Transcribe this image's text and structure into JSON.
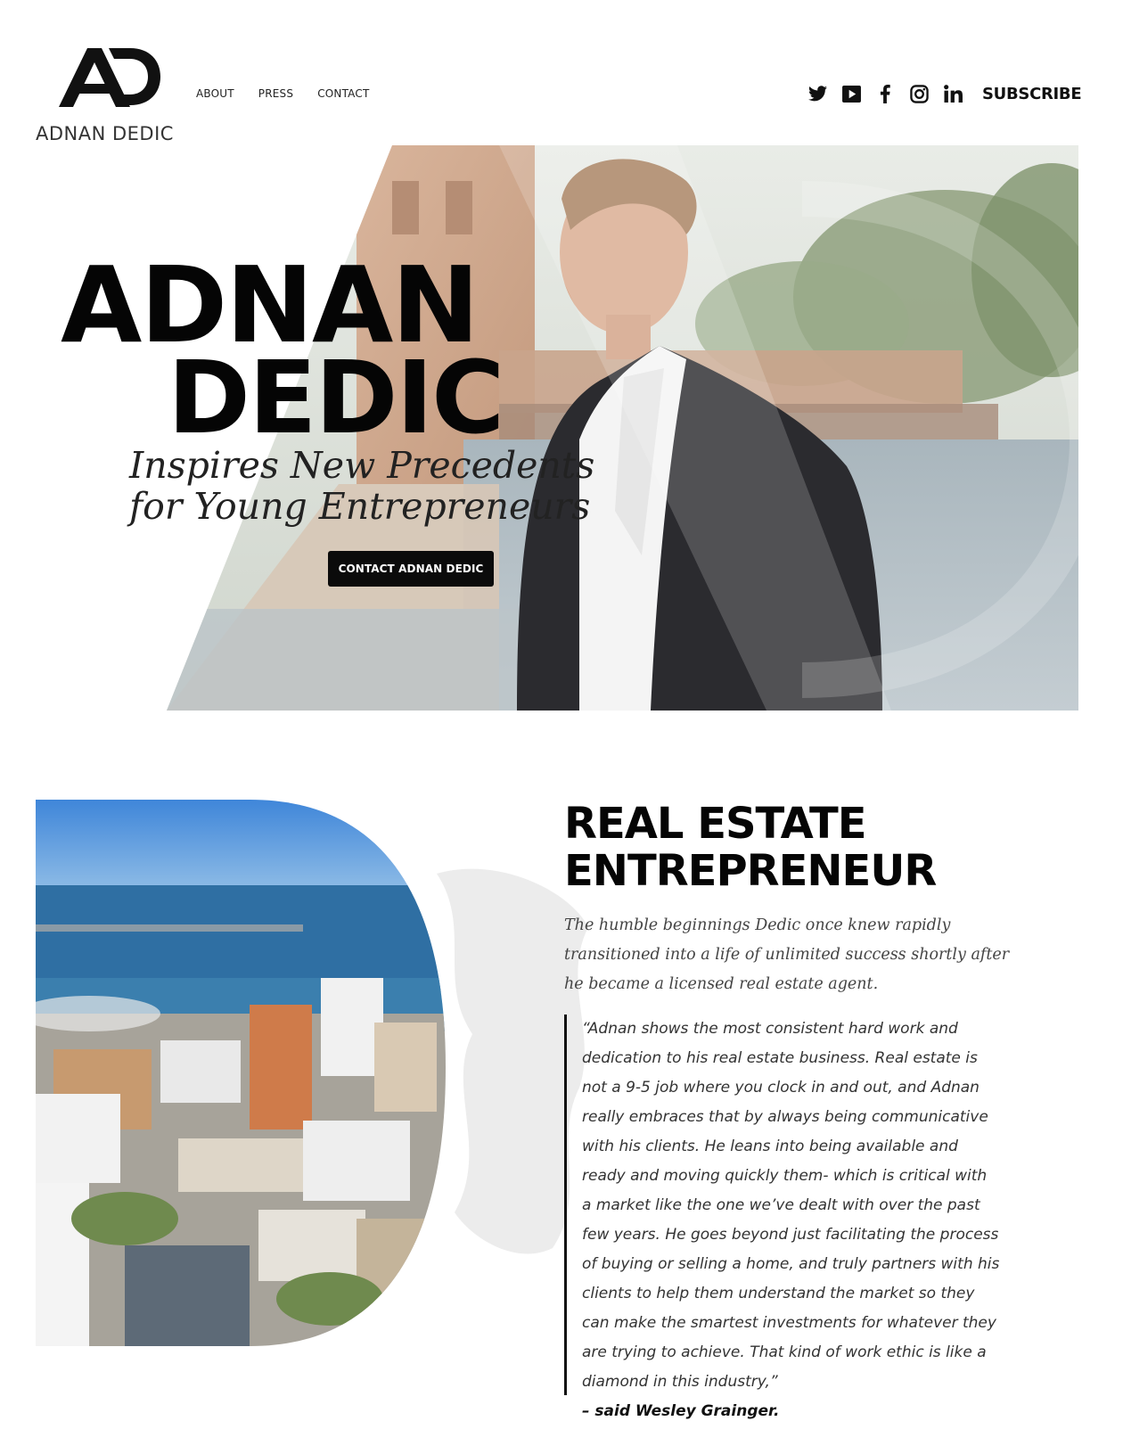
{
  "header": {
    "logo_text": "ADNAN DEDIC",
    "nav": [
      {
        "label": "ABOUT"
      },
      {
        "label": "PRESS"
      },
      {
        "label": "CONTACT"
      }
    ],
    "social_icons": [
      "twitter-icon",
      "youtube-icon",
      "facebook-icon",
      "instagram-icon",
      "linkedin-icon"
    ],
    "subscribe_label": "SUBSCRIBE"
  },
  "hero": {
    "name_line1": "ADNAN",
    "name_line2": "DEDIC",
    "tagline_line1": "Inspires New Precedents",
    "tagline_line2": "for Young Entrepreneurs",
    "cta_label": "CONTACT ADNAN DEDIC"
  },
  "section": {
    "title_line1": "REAL ESTATE",
    "title_line2": "ENTREPRENEUR",
    "intro": "The humble beginnings Dedic once knew rapidly transitioned into a life of unlimited success shortly after he became a licensed real estate agent.",
    "quote": "“Adnan shows the most consistent hard work and dedication to his real estate business. Real estate is not a 9-5 job where you clock in and out, and Adnan really embraces that by always being communicative with his clients. He leans into being available and ready and moving quickly them- which is critical with a market like the one we’ve dealt with over the past few years. He goes beyond just facilitating the process of buying or selling a home, and truly partners with his clients to help them understand the market so they can make the smartest investments for whatever they are trying to achieve. That kind of work ethic is like a diamond in this industry,”",
    "attribution": "– said Wesley Grainger."
  },
  "colors": {
    "text": "#050505",
    "button_bg": "#0b0b0b",
    "button_text": "#ffffff",
    "sky": "#4a8fd6",
    "water": "#2f6fa3"
  }
}
